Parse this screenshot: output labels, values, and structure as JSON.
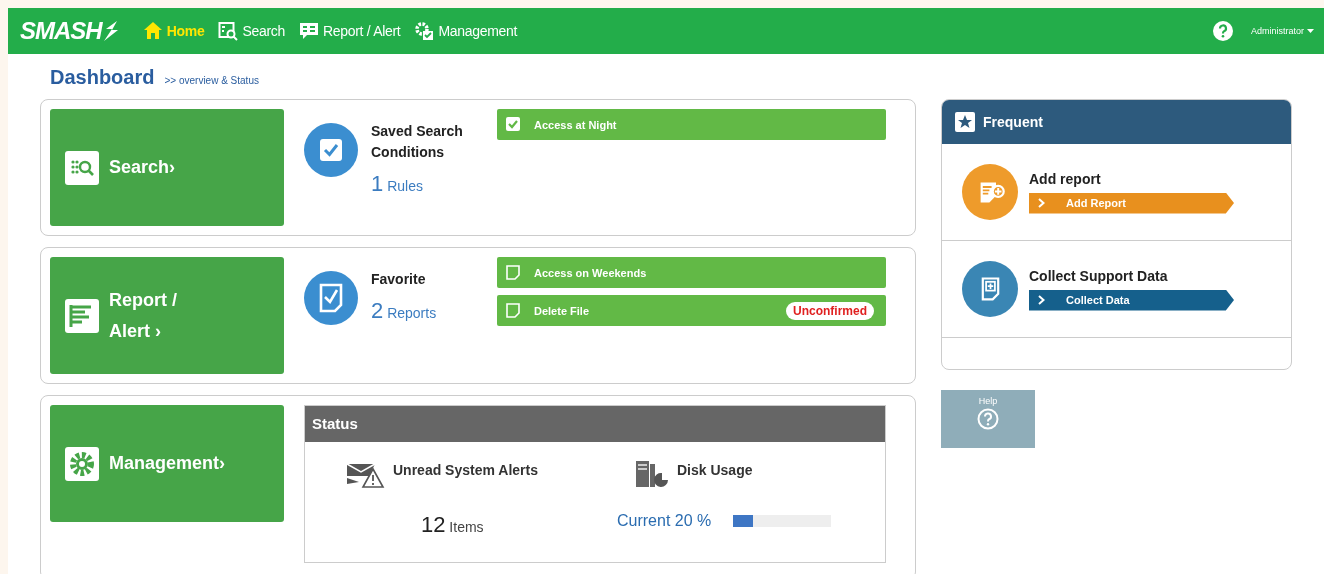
{
  "header": {
    "logo": "SMASH",
    "nav": [
      {
        "label": "Home",
        "kind": "home",
        "selected": true
      },
      {
        "label": "Search",
        "kind": "search",
        "selected": false
      },
      {
        "label": "Report / Alert",
        "kind": "report",
        "selected": false
      },
      {
        "label": "Management",
        "kind": "management",
        "selected": false
      }
    ],
    "user": "Administrator"
  },
  "page": {
    "title": "Dashboard",
    "breadcrumb": ">> overview & Status"
  },
  "sections": [
    {
      "kind": "summary",
      "tile": {
        "kind": "search",
        "lines": [
          "Search›"
        ]
      },
      "title": "Saved Search Conditions",
      "count": "1",
      "unit": "Rules",
      "entries": [
        {
          "kind": "checked",
          "label": "Access at Night"
        }
      ]
    },
    {
      "kind": "summary",
      "tile": {
        "kind": "report",
        "lines": [
          "Report /",
          "Alert ›"
        ]
      },
      "title": "Favorite",
      "count": "2",
      "unit": "Reports",
      "entries": [
        {
          "kind": "document",
          "label": "Access on Weekends"
        },
        {
          "kind": "document",
          "label": "Delete File",
          "badge": "Unconfirmed"
        }
      ]
    },
    {
      "kind": "status",
      "tile": {
        "kind": "management",
        "lines": [
          "Management›"
        ]
      },
      "title": "Status",
      "items": [
        {
          "kind": "alerts",
          "label": "Unread System Alerts",
          "count": "12",
          "unit": "Items"
        },
        {
          "kind": "disk",
          "label": "Disk Usage",
          "reading": "Current 20 %",
          "level": 0.2
        }
      ]
    }
  ],
  "frequent": {
    "title": "Frequent",
    "items": [
      {
        "kind": "add",
        "title": "Add report",
        "button": "Add Report",
        "color": "#e8901e"
      },
      {
        "kind": "collect",
        "title": "Collect Support Data",
        "button": "Collect Data",
        "color": "#15608c"
      }
    ]
  },
  "help": {
    "label": "Help"
  }
}
